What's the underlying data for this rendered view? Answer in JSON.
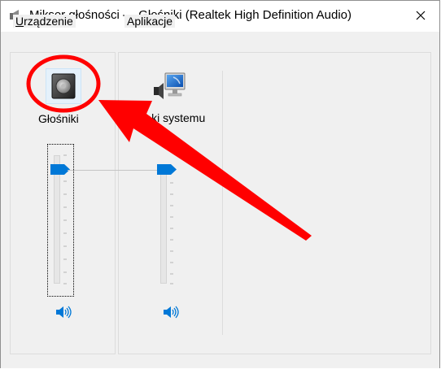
{
  "window": {
    "title": "Mikser głośności — Głośniki (Realtek High Definition Audio)"
  },
  "devices_group": {
    "label_underlined": "U",
    "label_rest": "rządzenie",
    "device_name": "Głośniki",
    "volume_level": 0.9
  },
  "apps_group": {
    "label": "Aplikacje",
    "app_name": "Dźwięki systemu",
    "volume_level": 0.9
  },
  "colors": {
    "accent": "#0078d7",
    "annotation": "#ff0000"
  }
}
